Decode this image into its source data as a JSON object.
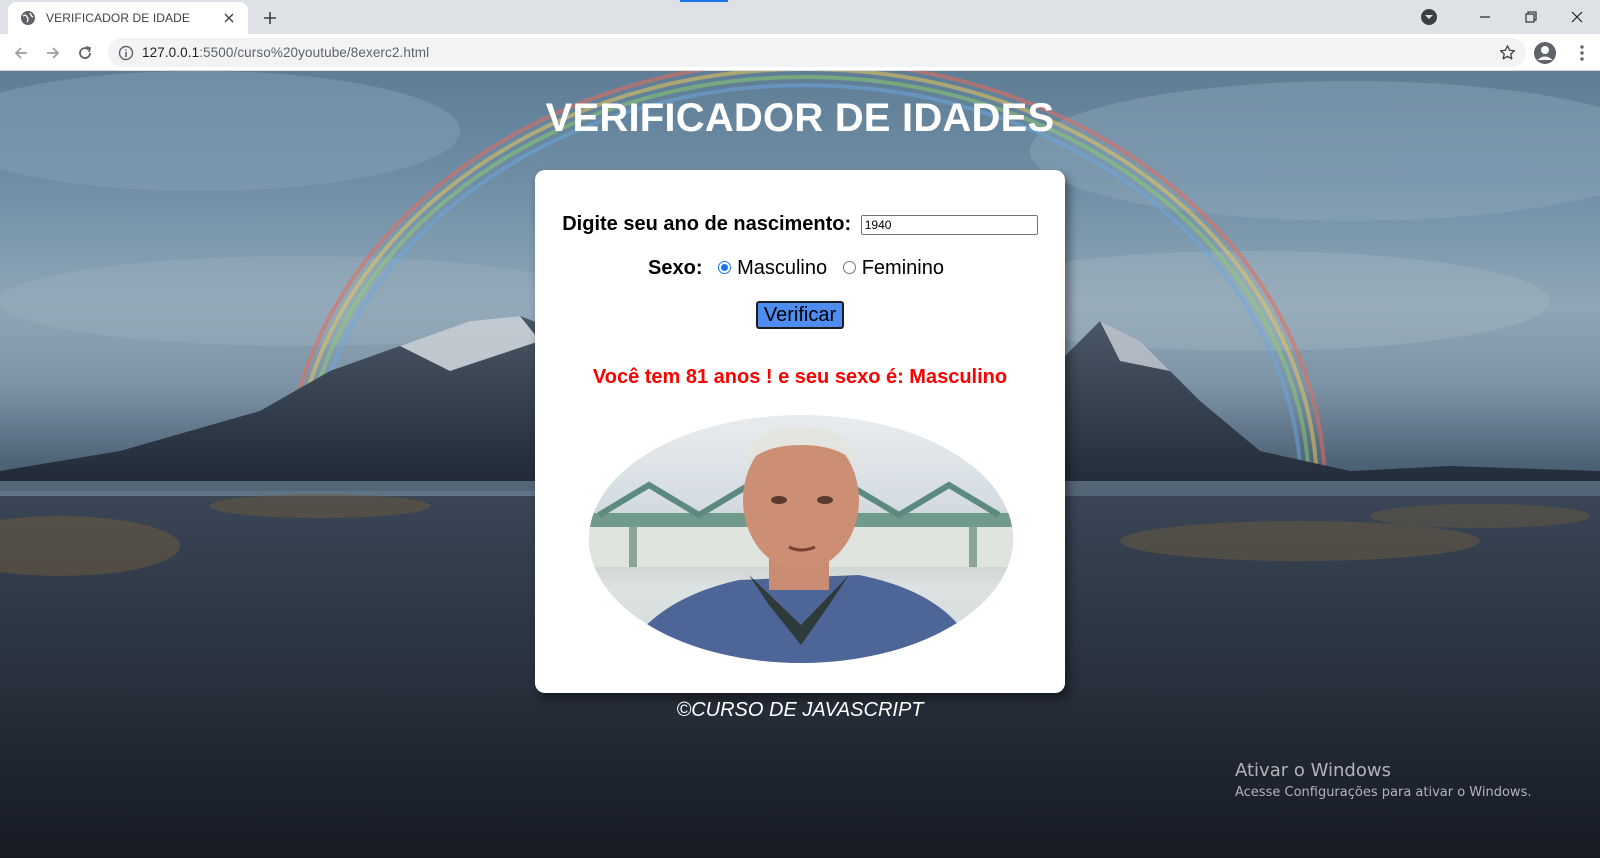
{
  "browser": {
    "tab_title": "VERIFICADOR DE IDADE",
    "url_host": "127.0.0.1",
    "url_rest": ":5500/curso%20youtube/8exerc2.html"
  },
  "page": {
    "heading": "VERIFICADOR DE IDADES",
    "year_label": "Digite seu ano de nascimento:",
    "year_value": "1940",
    "sex_label": "Sexo:",
    "sex_options": [
      "Masculino",
      "Feminino"
    ],
    "sex_selected": "Masculino",
    "verify_label": "Verificar",
    "result_text": "Você tem 81 anos ! e seu sexo é: Masculino",
    "footer": "©CURSO DE JAVASCRIPT"
  },
  "overlay": {
    "activate_title": "Ativar o Windows",
    "activate_sub": "Acesse Configurações para ativar o Windows."
  },
  "colors": {
    "result": "#ff0000",
    "button": "#4e8cf0",
    "tab_accent": "#1a73e8"
  },
  "icons": [
    "globe-icon",
    "close-icon",
    "plus-icon",
    "back-arrow-icon",
    "forward-arrow-icon",
    "reload-icon",
    "info-icon",
    "star-icon",
    "profile-icon",
    "more-vert-icon",
    "chevron-down-icon",
    "minimize-icon",
    "restore-icon"
  ]
}
